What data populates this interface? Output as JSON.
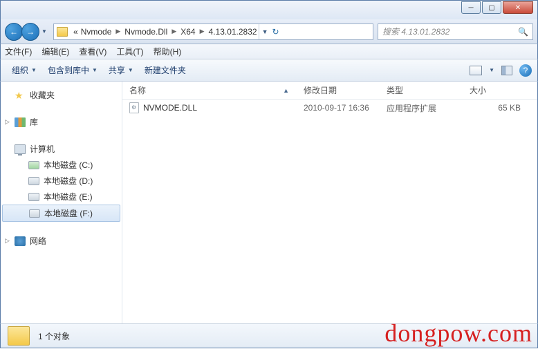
{
  "breadcrumb": {
    "prefix": "«",
    "parts": [
      "Nvmode",
      "Nvmode.Dll",
      "X64",
      "4.13.01.2832"
    ]
  },
  "search": {
    "placeholder": "搜索 4.13.01.2832"
  },
  "menu": {
    "file": "文件(F)",
    "edit": "编辑(E)",
    "view": "查看(V)",
    "tools": "工具(T)",
    "help": "帮助(H)"
  },
  "toolbar": {
    "organize": "组织",
    "include": "包含到库中",
    "share": "共享",
    "newfolder": "新建文件夹"
  },
  "sidebar": {
    "favorites": "收藏夹",
    "libraries": "库",
    "computer": "计算机",
    "disks": [
      {
        "label": "本地磁盘 (C:)"
      },
      {
        "label": "本地磁盘 (D:)"
      },
      {
        "label": "本地磁盘 (E:)"
      },
      {
        "label": "本地磁盘 (F:)"
      }
    ],
    "network": "网络"
  },
  "columns": {
    "name": "名称",
    "date": "修改日期",
    "type": "类型",
    "size": "大小"
  },
  "files": [
    {
      "name": "NVMODE.DLL",
      "date": "2010-09-17 16:36",
      "type": "应用程序扩展",
      "size": "65 KB"
    }
  ],
  "status": {
    "count": "1 个对象"
  },
  "watermark": "dongpow.com"
}
